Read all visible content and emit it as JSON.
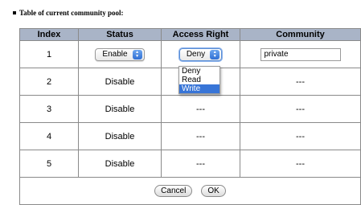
{
  "heading": "Table of current community pool:",
  "table": {
    "headers": [
      "Index",
      "Status",
      "Access Right",
      "Community"
    ],
    "rows": [
      {
        "index": "1",
        "status": "Enable",
        "access": "Deny",
        "community": "private"
      },
      {
        "index": "2",
        "status": "Disable",
        "access": "",
        "community": "---"
      },
      {
        "index": "3",
        "status": "Disable",
        "access": "---",
        "community": "---"
      },
      {
        "index": "4",
        "status": "Disable",
        "access": "---",
        "community": "---"
      },
      {
        "index": "5",
        "status": "Disable",
        "access": "---",
        "community": "---"
      }
    ]
  },
  "access_dropdown": {
    "options": [
      "Deny",
      "Read",
      "Write"
    ],
    "highlighted": "Write"
  },
  "buttons": {
    "cancel": "Cancel",
    "ok": "OK"
  },
  "colors": {
    "header_bg": "#a9b4c7",
    "highlight": "#3875d7",
    "stepper": "#2f6fd4"
  },
  "icons": {
    "select_arrows": "up-down-arrows-icon",
    "bullet": "square-bullet-icon"
  }
}
